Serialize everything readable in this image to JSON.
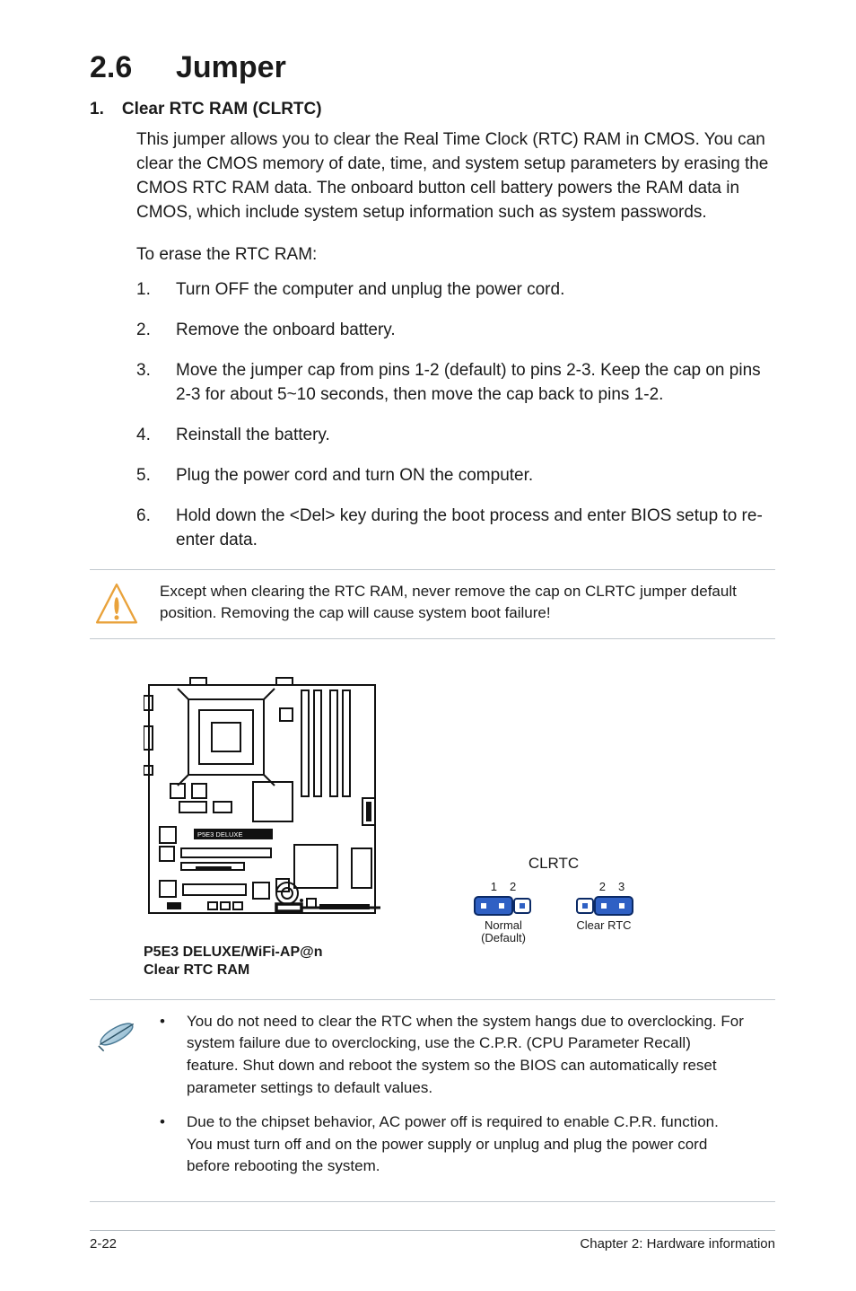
{
  "heading": {
    "number": "2.6",
    "title": "Jumper"
  },
  "item1": {
    "num": "1.",
    "title": "Clear RTC RAM (CLRTC)"
  },
  "intro_para": "This jumper allows you to clear the  Real Time Clock (RTC) RAM in CMOS. You can clear the CMOS memory of date, time, and system setup parameters by erasing the CMOS RTC RAM data. The onboard button cell battery powers the RAM data in CMOS, which include system setup information such as system passwords.",
  "erase_line": "To erase the RTC RAM:",
  "steps": [
    {
      "n": "1.",
      "t": "Turn OFF the computer and unplug the power cord."
    },
    {
      "n": "2.",
      "t": "Remove the onboard battery."
    },
    {
      "n": "3.",
      "t": "Move the jumper cap from pins 1-2 (default) to pins 2-3. Keep the cap on pins 2-3 for about 5~10 seconds, then move the cap back to pins 1-2."
    },
    {
      "n": "4.",
      "t": "Reinstall the battery."
    },
    {
      "n": "5.",
      "t": "Plug the power cord and turn ON the computer."
    },
    {
      "n": "6.",
      "t": "Hold down the <Del> key during the boot process and enter BIOS setup to re-enter data."
    }
  ],
  "caution_text": "Except when clearing the RTC RAM, never remove the cap on CLRTC jumper default position. Removing the cap will cause system boot failure!",
  "diagram": {
    "board_text": "P5E3 DELUXE",
    "caption_line1": "P5E3 DELUXE/WiFi-AP@n",
    "caption_line2": "Clear RTC RAM",
    "jumper_title": "CLRTC",
    "left": {
      "pins": [
        "1",
        "2"
      ],
      "label_line1": "Normal",
      "label_line2": "(Default)"
    },
    "right": {
      "pins": [
        "2",
        "3"
      ],
      "label_line1": "Clear RTC"
    }
  },
  "notes": [
    "You do not need to clear the RTC when the system hangs due to overclocking. For system failure due to overclocking, use the C.P.R. (CPU Parameter Recall) feature. Shut down and reboot the system so the BIOS can automatically reset parameter settings to default values.",
    "Due to the chipset behavior, AC power off is required to enable C.P.R. function. You must turn off and on the power supply or unplug and plug the power cord before rebooting the system."
  ],
  "footer": {
    "left": "2-22",
    "right": "Chapter 2: Hardware information"
  }
}
